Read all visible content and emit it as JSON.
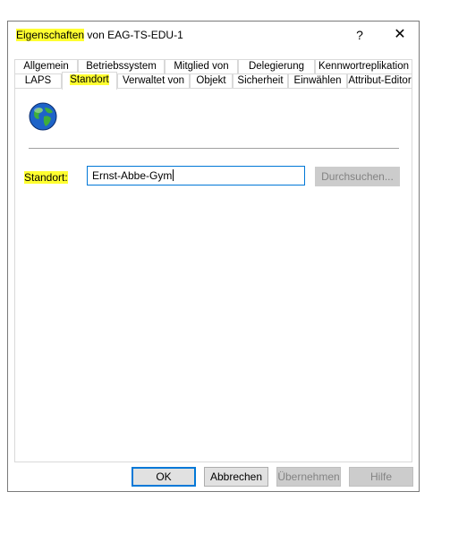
{
  "window": {
    "title_highlight": "Eigenschaften",
    "title_rest": " von EAG-TS-EDU-1",
    "help_label": "?",
    "close_label": "✕"
  },
  "tabs": {
    "row1": [
      "Allgemein",
      "Betriebssystem",
      "Mitglied von",
      "Delegierung",
      "Kennwortreplikation"
    ],
    "row2": [
      "LAPS",
      "Standort",
      "Verwaltet von",
      "Objekt",
      "Sicherheit",
      "Einwählen",
      "Attribut-Editor"
    ],
    "active": "Standort"
  },
  "standort": {
    "icon": "globe-icon",
    "label": "Standort:",
    "value": "Ernst-Abbe-Gym",
    "browse_label": "Durchsuchen..."
  },
  "buttons": {
    "ok": "OK",
    "cancel": "Abbrechen",
    "apply": "Übernehmen",
    "help": "Hilfe"
  },
  "colors": {
    "highlight": "#ffff30",
    "focus_accent": "#0078d7"
  }
}
